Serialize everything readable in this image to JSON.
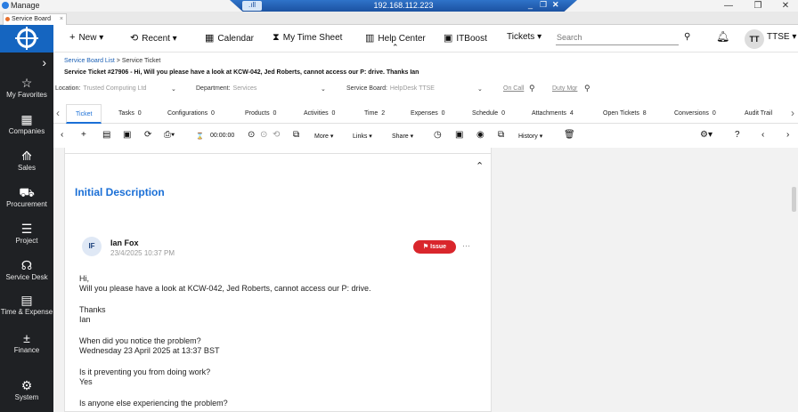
{
  "window": {
    "title": "Manage",
    "remote_ip": "192.168.112.223",
    "remote_signal": ".ıll"
  },
  "browser_tab": {
    "label": "Service Board",
    "close": "×"
  },
  "nav": {
    "items": [
      {
        "label": "My Favorites",
        "icon": "star-icon",
        "glyph": "☆"
      },
      {
        "label": "Companies",
        "icon": "building-icon",
        "glyph": "▦"
      },
      {
        "label": "Sales",
        "icon": "chart-icon",
        "glyph": "⟰"
      },
      {
        "label": "Procurement",
        "icon": "cart-icon",
        "glyph": "⛟"
      },
      {
        "label": "Project",
        "icon": "project-icon",
        "glyph": "☰"
      },
      {
        "label": "Service Desk",
        "icon": "headset-icon",
        "glyph": "☊"
      },
      {
        "label": "Time & Expense",
        "icon": "timesheet-icon",
        "glyph": "▤"
      },
      {
        "label": "Finance",
        "icon": "calculator-icon",
        "glyph": "±"
      },
      {
        "label": "System",
        "icon": "gear-icon",
        "glyph": "⚙"
      }
    ],
    "expand_glyph": "›"
  },
  "topbar": {
    "new": "New",
    "recent": "Recent",
    "calendar": "Calendar",
    "timesheet": "My Time Sheet",
    "help": "Help Center",
    "itboost": "ITBoost",
    "tickets": "Tickets",
    "search_placeholder": "Search",
    "user_initials": "TT",
    "user_label": "TTSE"
  },
  "breadcrumb": {
    "list": "Service Board List",
    "sep": ">",
    "current": "Service Ticket"
  },
  "ticket_title": "Service Ticket #27906 - Hi, Will you please have a look at KCW-042, Jed Roberts, cannot access our P: drive. Thanks Ian",
  "filters": {
    "location_label": "Location:",
    "location_value": "Trusted Computing Ltd",
    "department_label": "Department:",
    "department_value": "Services",
    "board_label": "Service Board:",
    "board_value": "HelpDesk TTSE",
    "oncall": "On Call",
    "dutymgr": "Duty Mgr"
  },
  "tabs": [
    {
      "label": "Ticket",
      "count": ""
    },
    {
      "label": "Tasks",
      "count": "0"
    },
    {
      "label": "Configurations",
      "count": "0"
    },
    {
      "label": "Products",
      "count": "0"
    },
    {
      "label": "Activities",
      "count": "0"
    },
    {
      "label": "Time",
      "count": "2"
    },
    {
      "label": "Expenses",
      "count": "0"
    },
    {
      "label": "Schedule",
      "count": "0"
    },
    {
      "label": "Attachments",
      "count": "4"
    },
    {
      "label": "Open Tickets",
      "count": "8"
    },
    {
      "label": "Conversions",
      "count": "0"
    },
    {
      "label": "Audit Trail",
      "count": ""
    }
  ],
  "actions": {
    "timer": "00:00:00",
    "more": "More",
    "links": "Links",
    "share": "Share",
    "history": "History"
  },
  "section_title": "Initial Description",
  "message": {
    "initials": "IF",
    "author": "Ian Fox",
    "date": "23/4/2025 10:37 PM",
    "badge": "Issue",
    "lines": [
      "Hi,",
      "Will you please have a look at KCW-042, Jed Roberts, cannot access our P: drive.",
      "Thanks",
      "Ian",
      "When did you notice the problem?",
      "Wednesday 23 April 2025 at 13:37 BST",
      "Is it preventing you from doing work?",
      "Yes",
      "Is anyone else experiencing the problem?"
    ]
  },
  "colors": {
    "accent": "#1a6fd6",
    "badge": "#d9262c",
    "nav_bg": "#1f2124",
    "logo_bg": "#1565c0"
  }
}
